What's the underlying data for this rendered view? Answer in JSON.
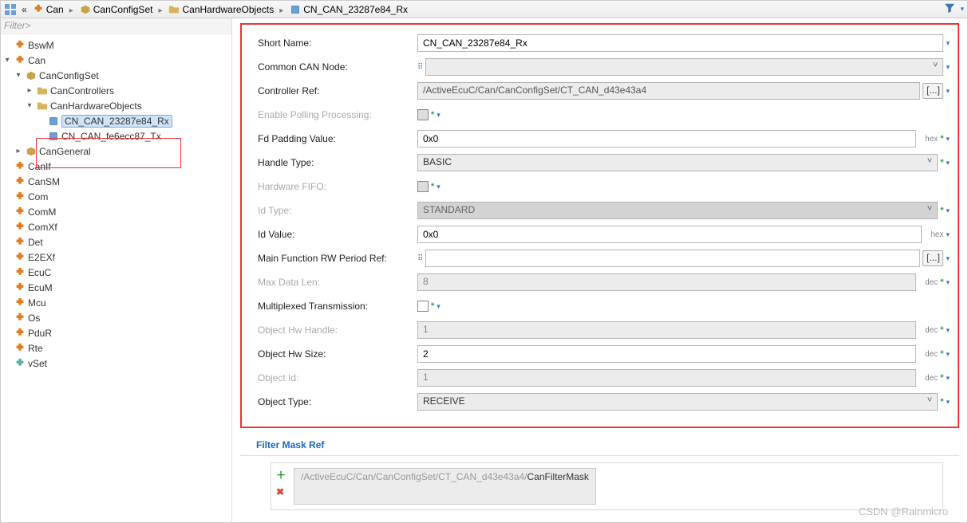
{
  "breadcrumb": {
    "items": [
      "Can",
      "CanConfigSet",
      "CanHardwareObjects",
      "CN_CAN_23287e84_Rx"
    ]
  },
  "filter_placeholder": "Filter>",
  "tree": {
    "n_bswm": "BswM",
    "n_can": "Can",
    "n_canconfigset": "CanConfigSet",
    "n_cancontrollers": "CanControllers",
    "n_canhwobjs": "CanHardwareObjects",
    "n_rx": "CN_CAN_23287e84_Rx",
    "n_tx": "CN_CAN_fe6ecc87_Tx",
    "n_cangeneral": "CanGeneral",
    "n_canif": "CanIf",
    "n_cansm": "CanSM",
    "n_com": "Com",
    "n_comm": "ComM",
    "n_comxf": "ComXf",
    "n_det": "Det",
    "n_e2exf": "E2EXf",
    "n_ecuc": "EcuC",
    "n_ecum": "EcuM",
    "n_mcu": "Mcu",
    "n_os": "Os",
    "n_pdur": "PduR",
    "n_rte": "Rte",
    "n_vset": "vSet"
  },
  "form": {
    "short_name": {
      "label": "Short Name:",
      "value": "CN_CAN_23287e84_Rx"
    },
    "common_can": {
      "label": "Common CAN Node:",
      "value": ""
    },
    "ctrl_ref": {
      "label": "Controller Ref:",
      "value": "/ActiveEcuC/Can/CanConfigSet/CT_CAN_d43e43a4",
      "dots": "[...]"
    },
    "polling": {
      "label": "Enable Polling Processing:"
    },
    "fd_padding": {
      "label": "Fd Padding Value:",
      "value": "0x0",
      "unit": "hex"
    },
    "handle_type": {
      "label": "Handle Type:",
      "value": "BASIC"
    },
    "hw_fifo": {
      "label": "Hardware FIFO:"
    },
    "id_type": {
      "label": "Id Type:",
      "value": "STANDARD"
    },
    "id_value": {
      "label": "Id Value:",
      "value": "0x0",
      "unit": "hex"
    },
    "mf_rw_ref": {
      "label": "Main Function RW Period Ref:",
      "value": "",
      "dots": "[...]"
    },
    "max_data_len": {
      "label": "Max Data Len:",
      "value": "8",
      "unit": "dec"
    },
    "mux_tx": {
      "label": "Multiplexed Transmission:"
    },
    "obj_hw_handle": {
      "label": "Object Hw Handle:",
      "value": "1",
      "unit": "dec"
    },
    "obj_hw_size": {
      "label": "Object Hw Size:",
      "value": "2",
      "unit": "dec"
    },
    "obj_id": {
      "label": "Object Id:",
      "value": "1",
      "unit": "dec"
    },
    "obj_type": {
      "label": "Object Type:",
      "value": "RECEIVE"
    }
  },
  "filter_mask": {
    "header": "Filter Mask Ref",
    "path_prefix": "/ActiveEcuC/Can/CanConfigSet/CT_CAN_d43e43a4/",
    "path_last": "CanFilterMask"
  },
  "watermark": "CSDN @Rainmicro"
}
